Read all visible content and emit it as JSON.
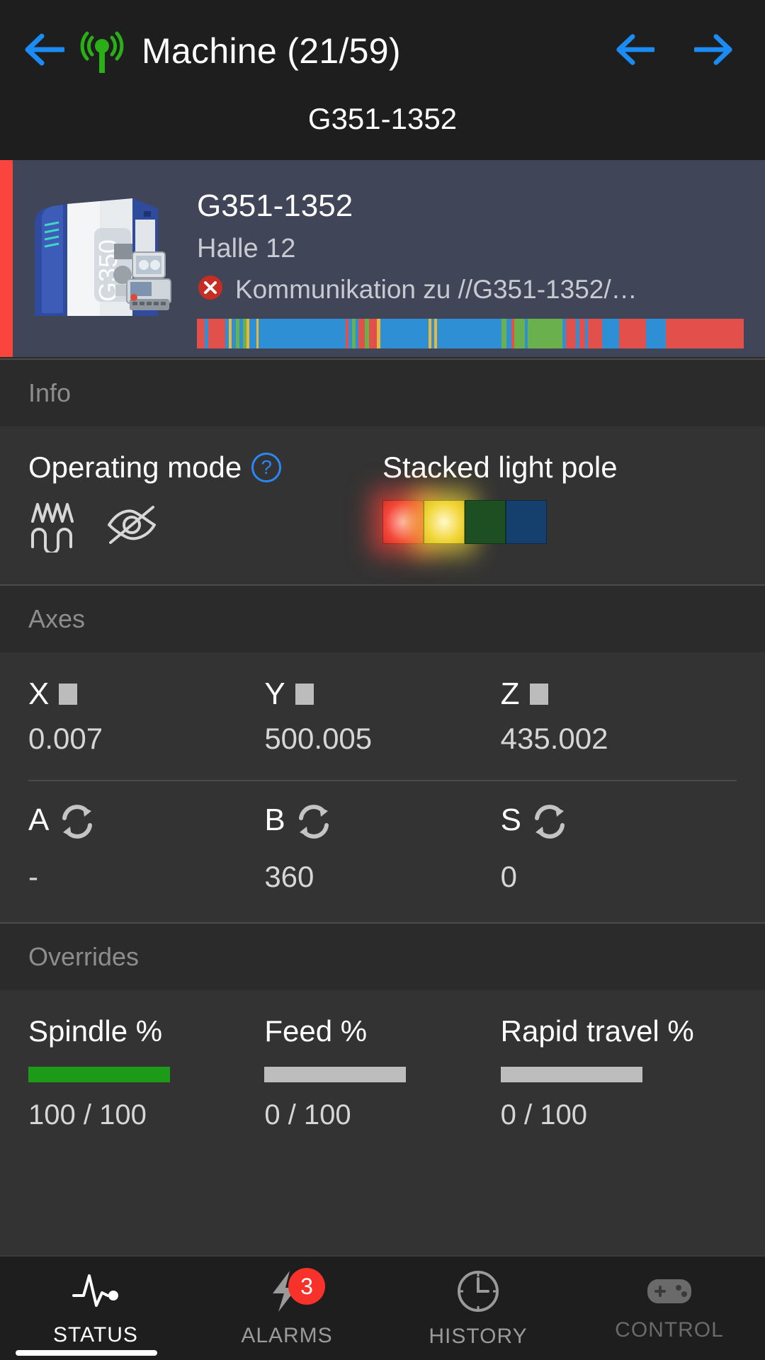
{
  "header": {
    "back_icon": "arrow-left-icon",
    "signal_icon": "broadcast-antenna-icon",
    "title": "Machine (21/59)",
    "prev_icon": "arrow-left-icon",
    "next_icon": "arrow-right-icon",
    "subtitle": "G351-1352"
  },
  "machine_card": {
    "status_color": "#f9453e",
    "thumbnail_label": "G350",
    "name": "G351-1352",
    "location": "Halle 12",
    "error_icon": "error-circle-icon",
    "message": "Kommunikation zu //G351-1352/…",
    "timeline": [
      {
        "color": "#e2504b",
        "w": 1.2
      },
      {
        "color": "#2e8fd4",
        "w": 0.6
      },
      {
        "color": "#e2504b",
        "w": 2.6
      },
      {
        "color": "#2e8fd4",
        "w": 0.5
      },
      {
        "color": "#e8b63c",
        "w": 0.5
      },
      {
        "color": "#2e8fd4",
        "w": 0.6
      },
      {
        "color": "#6ab04c",
        "w": 0.6
      },
      {
        "color": "#2e8fd4",
        "w": 0.6
      },
      {
        "color": "#6ab04c",
        "w": 0.5
      },
      {
        "color": "#e8b63c",
        "w": 0.5
      },
      {
        "color": "#2e8fd4",
        "w": 1.0
      },
      {
        "color": "#e8b63c",
        "w": 0.4
      },
      {
        "color": "#2e8fd4",
        "w": 13.5
      },
      {
        "color": "#e2504b",
        "w": 0.5
      },
      {
        "color": "#2e8fd4",
        "w": 0.5
      },
      {
        "color": "#6ab04c",
        "w": 0.5
      },
      {
        "color": "#2e8fd4",
        "w": 0.5
      },
      {
        "color": "#e2504b",
        "w": 1.0
      },
      {
        "color": "#6ab04c",
        "w": 0.6
      },
      {
        "color": "#e2504b",
        "w": 1.3
      },
      {
        "color": "#e8b63c",
        "w": 0.5
      },
      {
        "color": "#2e8fd4",
        "w": 7.5
      },
      {
        "color": "#e8b63c",
        "w": 0.4
      },
      {
        "color": "#2e8fd4",
        "w": 0.5
      },
      {
        "color": "#e8b63c",
        "w": 0.4
      },
      {
        "color": "#2e8fd4",
        "w": 10.0
      },
      {
        "color": "#6ab04c",
        "w": 0.8
      },
      {
        "color": "#2e8fd4",
        "w": 0.8
      },
      {
        "color": "#e2504b",
        "w": 0.4
      },
      {
        "color": "#6ab04c",
        "w": 1.6
      },
      {
        "color": "#2e8fd4",
        "w": 0.5
      },
      {
        "color": "#6ab04c",
        "w": 5.4
      },
      {
        "color": "#2e8fd4",
        "w": 0.5
      },
      {
        "color": "#e2504b",
        "w": 1.6
      },
      {
        "color": "#2e8fd4",
        "w": 0.5
      },
      {
        "color": "#e2504b",
        "w": 0.9
      },
      {
        "color": "#2e8fd4",
        "w": 0.5
      },
      {
        "color": "#e2504b",
        "w": 2.2
      },
      {
        "color": "#2e8fd4",
        "w": 2.6
      },
      {
        "color": "#e2504b",
        "w": 4.2
      },
      {
        "color": "#2e8fd4",
        "w": 3.1
      },
      {
        "color": "#e2504b",
        "w": 12.0
      }
    ]
  },
  "info": {
    "section_title": "Info",
    "operating_mode": {
      "label": "Operating mode",
      "help_glyph": "?",
      "help_icon": "help-circle-icon",
      "icons": [
        "waveform-icon",
        "eye-off-icon"
      ]
    },
    "stacked_light_pole": {
      "label": "Stacked light pole",
      "lamps": [
        {
          "name": "red-lamp",
          "color": "#f4463c",
          "lit": true
        },
        {
          "name": "yellow-lamp",
          "color": "#f2d73c",
          "lit": true
        },
        {
          "name": "green-lamp",
          "color": "#1d4f22",
          "lit": false
        },
        {
          "name": "blue-lamp",
          "color": "#15406e",
          "lit": false
        }
      ]
    }
  },
  "axes": {
    "section_title": "Axes",
    "linear": [
      {
        "name": "X",
        "value": "0.007"
      },
      {
        "name": "Y",
        "value": "500.005"
      },
      {
        "name": "Z",
        "value": "435.002"
      }
    ],
    "rotary": [
      {
        "name": "A",
        "value": "-"
      },
      {
        "name": "B",
        "value": "360"
      },
      {
        "name": "S",
        "value": "0"
      }
    ],
    "rotary_icon": "rotation-refresh-icon",
    "linear_icon": "square-indicator-icon"
  },
  "overrides": {
    "section_title": "Overrides",
    "items": [
      {
        "label": "Spindle %",
        "percent": 100,
        "value": "100 / 100",
        "color": "#1d9a18"
      },
      {
        "label": "Feed %",
        "percent": 0,
        "value": "0 / 100",
        "color": "#1d9a18"
      },
      {
        "label": "Rapid travel %",
        "percent": 0,
        "value": "0 / 100",
        "color": "#1d9a18"
      }
    ]
  },
  "bottom_nav": {
    "items": [
      {
        "label": "STATUS",
        "icon": "pulse-heartbeat-icon",
        "state": "active",
        "badge": null
      },
      {
        "label": "ALARMS",
        "icon": "lightning-bolt-icon",
        "state": "inactive",
        "badge": "3"
      },
      {
        "label": "HISTORY",
        "icon": "clock-icon",
        "state": "inactive",
        "badge": null
      },
      {
        "label": "CONTROL",
        "icon": "gamepad-icon",
        "state": "disabled",
        "badge": null
      }
    ]
  }
}
